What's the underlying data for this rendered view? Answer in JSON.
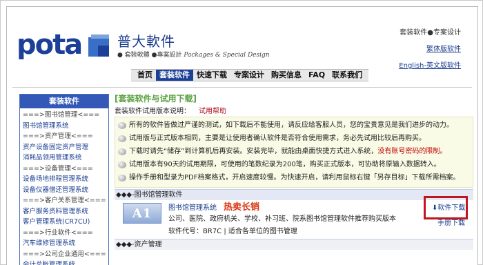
{
  "header": {
    "logo_text": "pota",
    "brand_cn": "普大軟件",
    "sub_a": "套裝軟體",
    "sub_b": "專案設計",
    "sub_en": "Packages & Special Design",
    "right_top": "套装软件●专案设计",
    "link_traditional": "繁体版软件",
    "link_english": "English-英文版软件"
  },
  "nav": {
    "items": [
      "首页",
      "套装软件",
      "快速下载",
      "专案设计",
      "购买信息",
      "FAQ",
      "联系我们"
    ],
    "active": "套装软件"
  },
  "sidebar": {
    "title": "套装软件",
    "items": [
      {
        "text": "===>图书馆管理<===",
        "type": "group"
      },
      {
        "text": "图书馆管理系统",
        "type": "link"
      },
      {
        "text": "===>资产管理<===",
        "type": "group"
      },
      {
        "text": "资产设备固定资产管理",
        "type": "link"
      },
      {
        "text": "消耗品领用管理系统",
        "type": "link"
      },
      {
        "text": "===>设备管理<===",
        "type": "group"
      },
      {
        "text": "设备场地排程管理系统",
        "type": "link"
      },
      {
        "text": "设备仪器借还管理系统",
        "type": "link"
      },
      {
        "text": "===>客户关系管理<===",
        "type": "group"
      },
      {
        "text": "客户服务资料管理系统",
        "type": "link"
      },
      {
        "text": "客户管理系统(CR7CU)",
        "type": "link"
      },
      {
        "text": "===>行业软件<===",
        "type": "group"
      },
      {
        "text": "汽车维修管理系统",
        "type": "link"
      },
      {
        "text": "===>公司企业通用<===",
        "type": "group"
      },
      {
        "text": "会计总帐管理系统",
        "type": "link"
      }
    ]
  },
  "main": {
    "title": "[套装软件与试用下载]",
    "sub_label": "套装软件试用版本说明：",
    "sub_help": "试用帮助",
    "notices": [
      {
        "text": "所有的软件皆做过严谨的测试，如下载后不能使用，请反应给客服人员，您的宝贵意见是我们进步的动力。",
        "red": ""
      },
      {
        "text": "试用版与正式版本相同，主要是让使用者确认软件是否符合使用需求，务必先试用比较后再购买。",
        "red": ""
      },
      {
        "text": "下载时请先“储存”到计算机后再安装。安装完毕，就能由桌面快捷方式进入系统，",
        "red": "没有账号密码的限制。"
      },
      {
        "text": "试用版本有90天的试用期限，可使用的笔数纪录为200笔，购买正式版本，可协助将原输入数据转入。",
        "red": ""
      },
      {
        "text": "操作手册和型录为PDF档案格式，开启速度较慢。为快速开启，请利用鼠标右键「另存目标」下载所需档案。",
        "red": ""
      }
    ],
    "category1": "◆◆◆-图书馆管理软件",
    "product": {
      "icon_text": "A1",
      "name": "图书馆管理系统",
      "hot": "热卖长销",
      "desc": "公司、医院、政府机关、学校、补习班、院系图书馆管理软件推荐购买版本",
      "code": "软件代号：BR7C | 适合各单位的图书管理",
      "download": "软件下载",
      "manual": "手册下载"
    },
    "category2": "◆◆◆-资产管理"
  }
}
